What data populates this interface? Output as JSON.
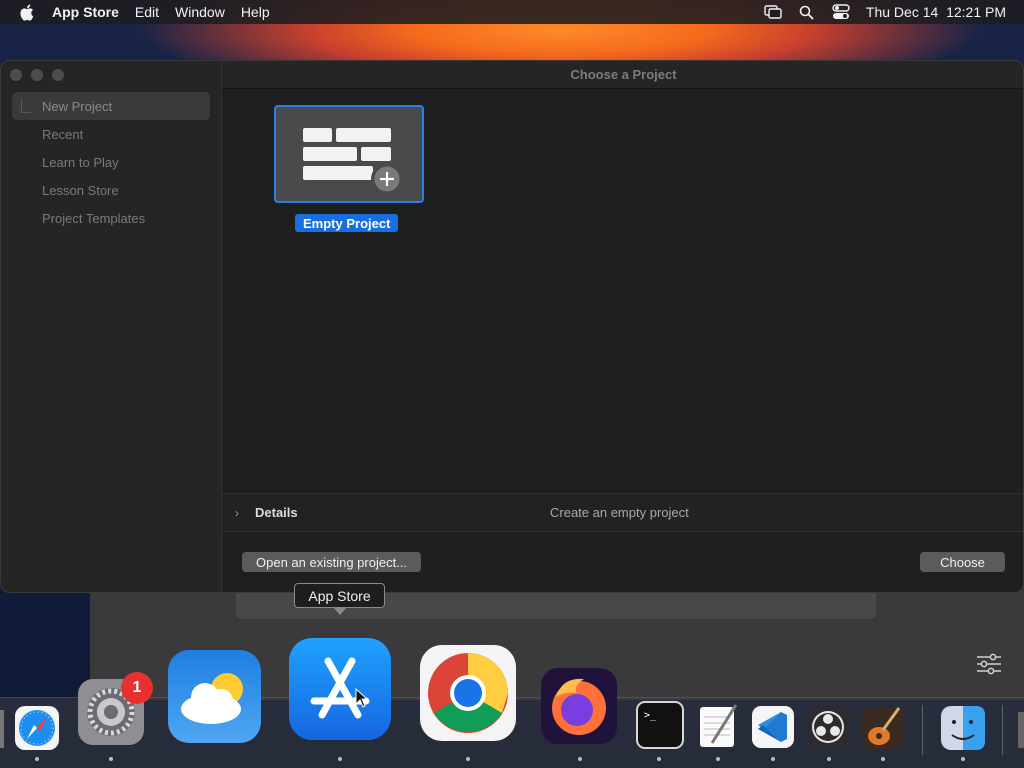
{
  "menubar": {
    "app_name": "App Store",
    "items": [
      "Edit",
      "Window",
      "Help"
    ],
    "datetime": "Thu Dec 14  12:21 PM"
  },
  "dialog": {
    "title": "Choose a Project",
    "sidebar_items": [
      {
        "label": "New Project",
        "selected": true
      },
      {
        "label": "Recent",
        "selected": false
      },
      {
        "label": "Learn to Play",
        "selected": false
      },
      {
        "label": "Lesson Store",
        "selected": false
      },
      {
        "label": "Project Templates",
        "selected": false
      }
    ],
    "project_tile": {
      "label": "Empty Project",
      "icon": "empty-project-icon"
    },
    "details": {
      "label": "Details",
      "description": "Create an empty project"
    },
    "buttons": {
      "open": "Open an existing project...",
      "choose": "Choose"
    }
  },
  "tooltip": {
    "text": "App Store"
  },
  "dock": {
    "items": [
      {
        "name": "safari",
        "icon": "safari-icon"
      },
      {
        "name": "system-settings",
        "icon": "gear-icon",
        "badge": "1"
      },
      {
        "name": "weather",
        "icon": "weather-icon"
      },
      {
        "name": "app-store",
        "icon": "app-store-icon"
      },
      {
        "name": "chrome",
        "icon": "chrome-icon"
      },
      {
        "name": "firefox",
        "icon": "firefox-icon"
      },
      {
        "name": "terminal",
        "icon": "terminal-icon"
      },
      {
        "name": "textedit",
        "icon": "textedit-icon"
      },
      {
        "name": "vscode",
        "icon": "vscode-icon"
      },
      {
        "name": "obs",
        "icon": "obs-icon"
      },
      {
        "name": "garageband",
        "icon": "garageband-icon"
      },
      {
        "name": "finder",
        "icon": "finder-icon"
      }
    ]
  },
  "colors": {
    "accent": "#1a6fe0",
    "badge": "#e8312f"
  }
}
